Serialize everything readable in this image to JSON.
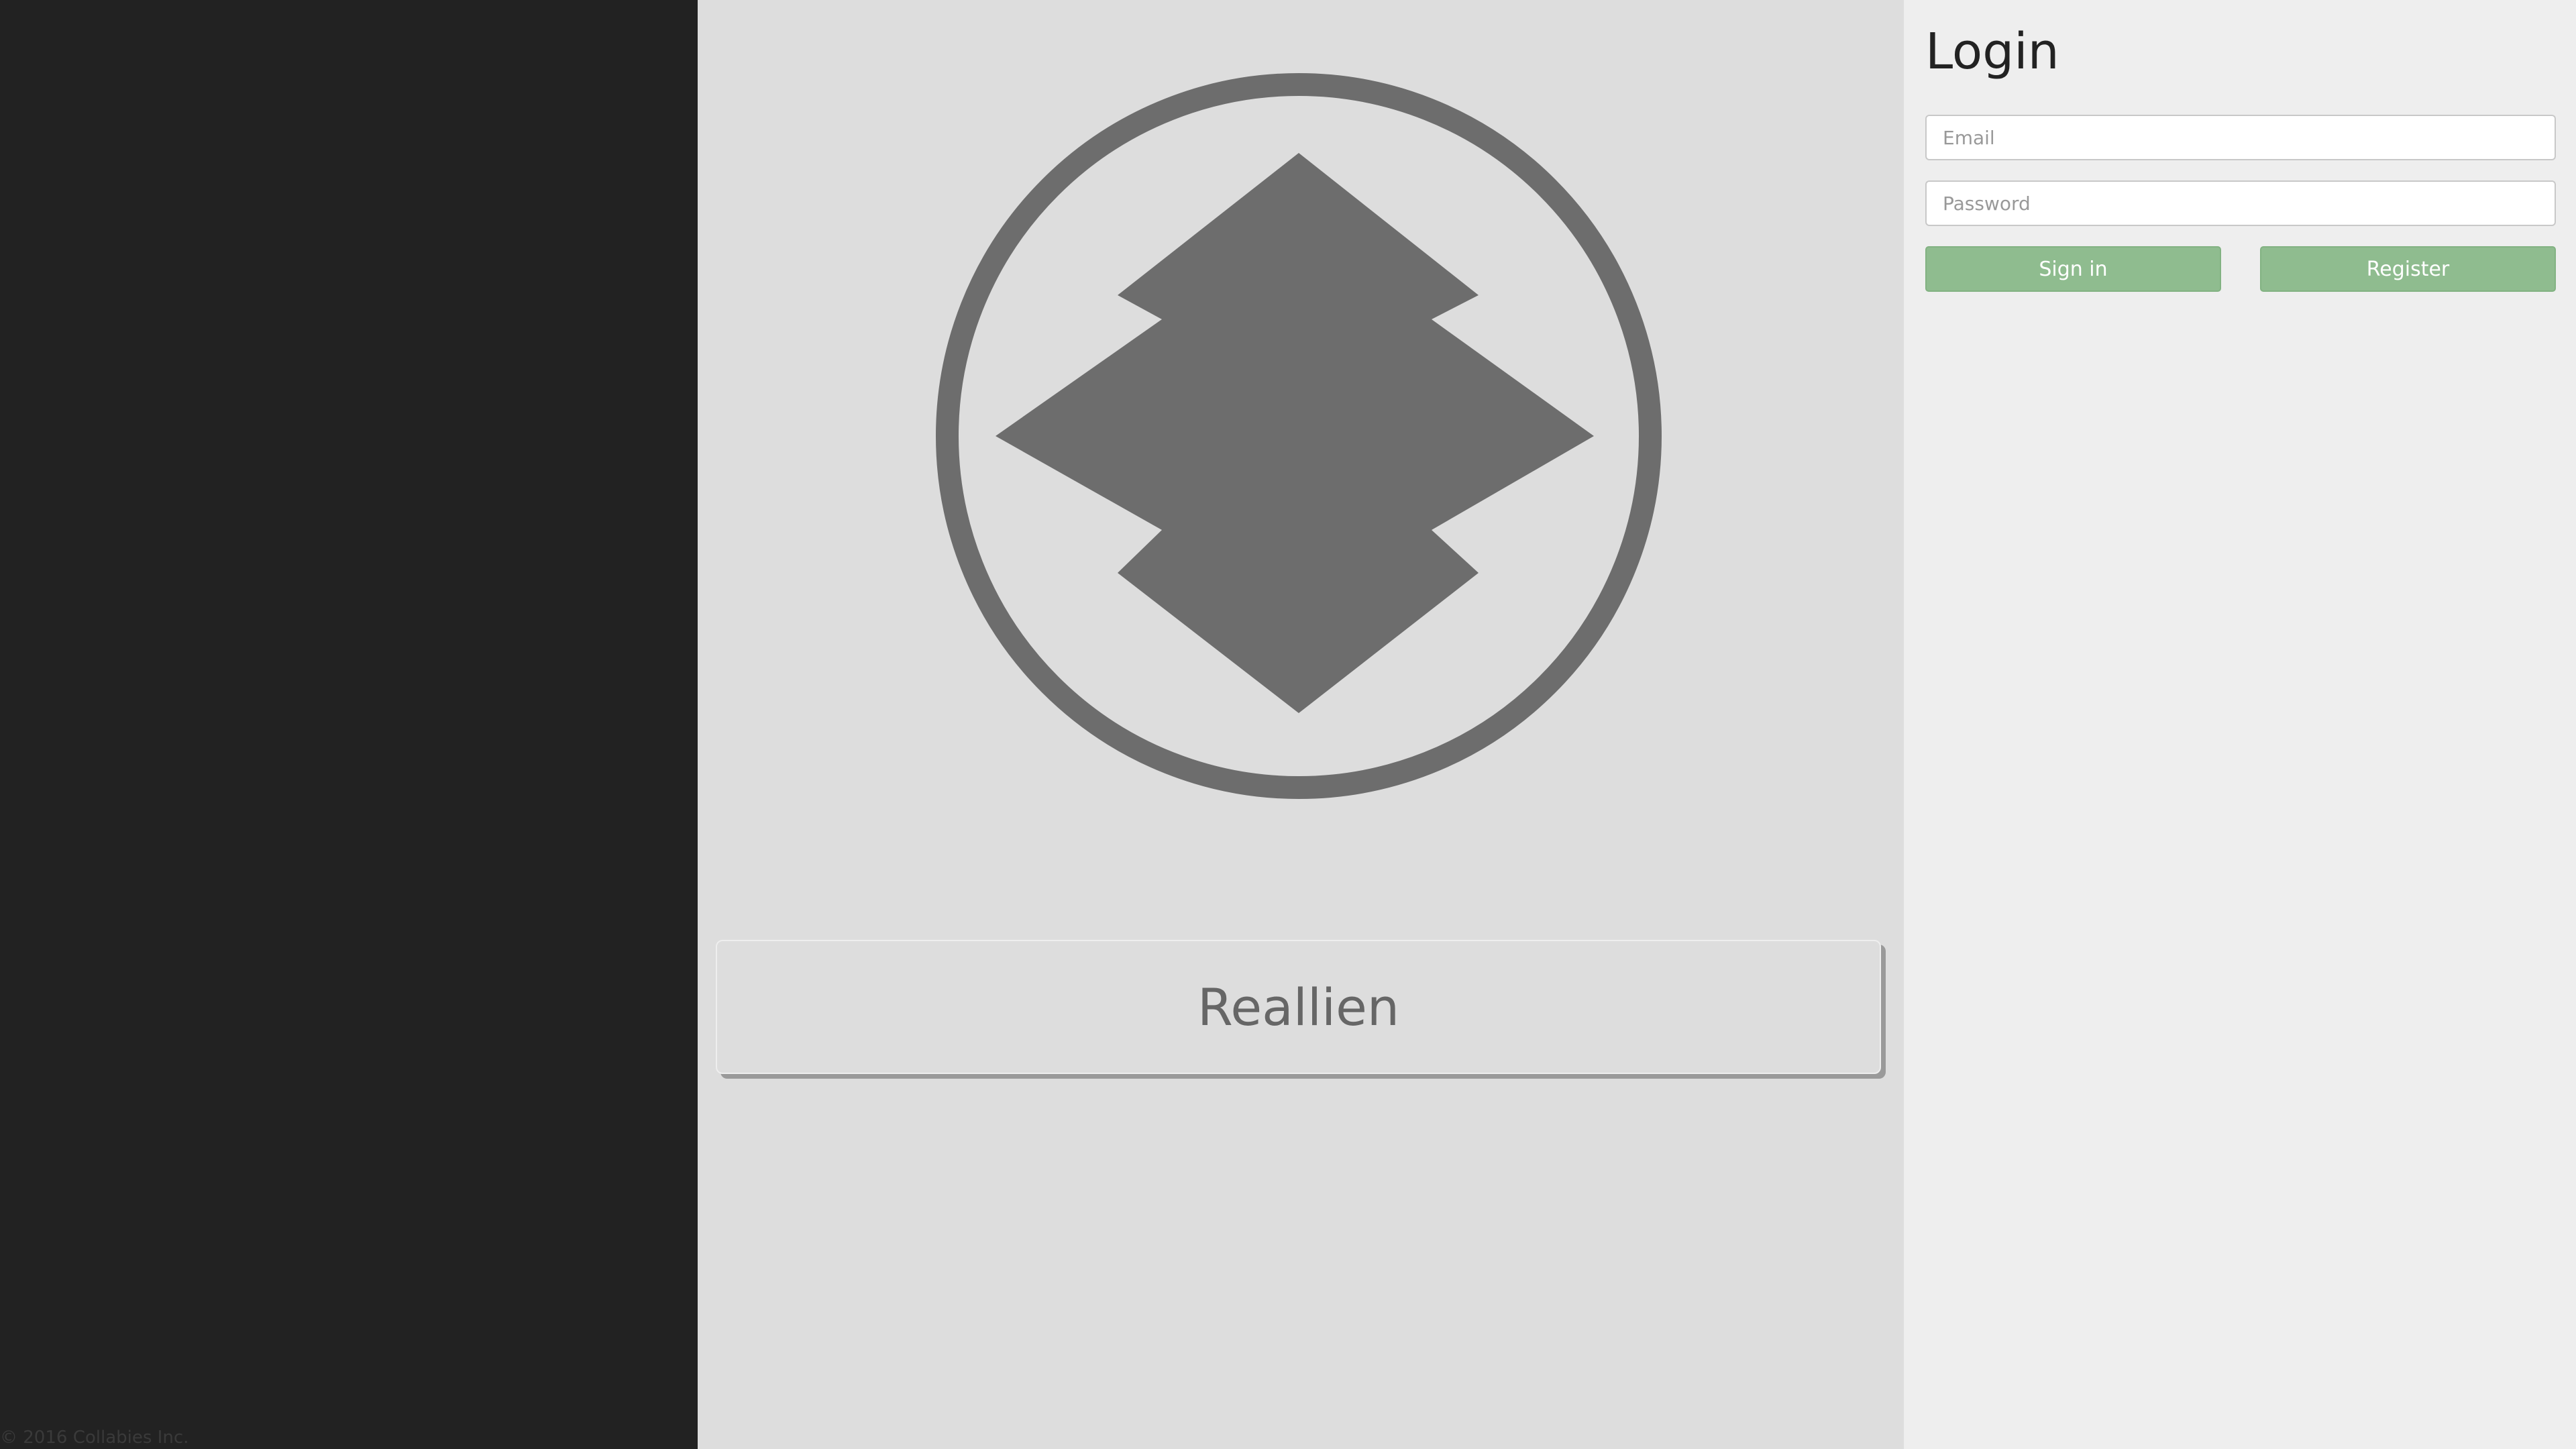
{
  "sidebar": {
    "copyright": "© 2016 Collabies Inc."
  },
  "main": {
    "logo_icon": "reallien-logo-icon",
    "app_name": "Reallien"
  },
  "login": {
    "title": "Login",
    "email_placeholder": "Email",
    "email_value": "",
    "password_placeholder": "Password",
    "password_value": "",
    "signin_label": "Sign in",
    "register_label": "Register"
  },
  "colors": {
    "sidebar_bg": "#222222",
    "main_bg": "#dddddd",
    "panel_bg": "#eeeeee",
    "logo": "#6d6d6d",
    "button_green": "#8fbc8f"
  }
}
